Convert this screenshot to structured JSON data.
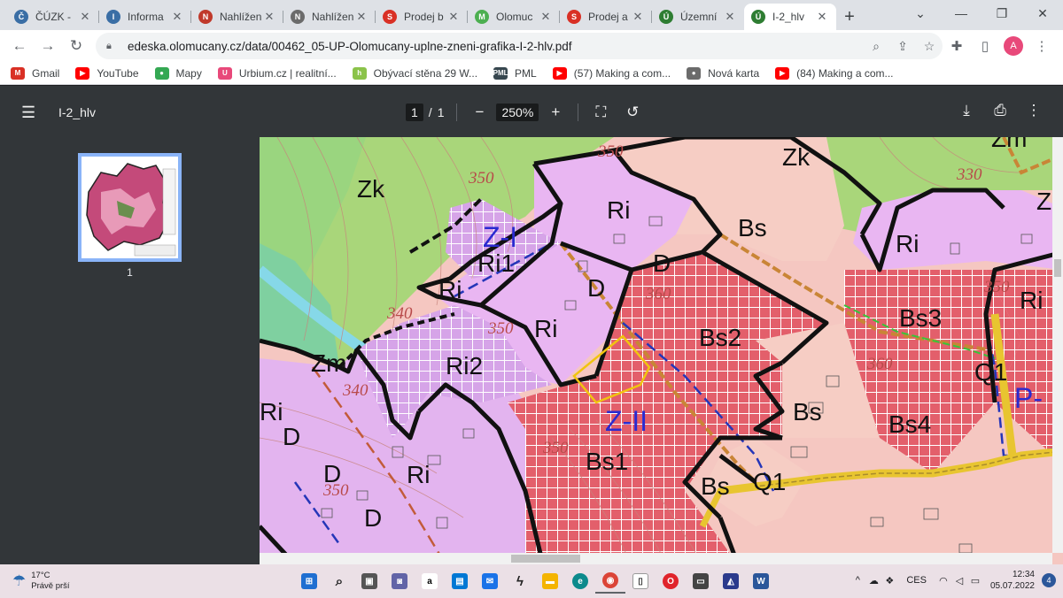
{
  "browser": {
    "tabs": [
      {
        "title": "ČÚZK -",
        "color": "#3a6ea5",
        "glyph": "Č"
      },
      {
        "title": "Informa",
        "color": "#3a6ea5",
        "glyph": "I"
      },
      {
        "title": "Nahlížen",
        "color": "#c0392b",
        "glyph": "N"
      },
      {
        "title": "Nahlížen",
        "color": "#6b6b6b",
        "glyph": "N"
      },
      {
        "title": "Prodej b",
        "color": "#d93025",
        "glyph": "S"
      },
      {
        "title": "Olomuc",
        "color": "#4caf50",
        "glyph": "M"
      },
      {
        "title": "Prodej a",
        "color": "#d93025",
        "glyph": "S"
      },
      {
        "title": "Územní",
        "color": "#2e7d32",
        "glyph": "Ú"
      },
      {
        "title": "I-2_hlv",
        "color": "#2e7d32",
        "glyph": "Ú",
        "active": true
      }
    ],
    "url": "edeska.olomucany.cz/data/00462_05-UP-Olomucany-uplne-zneni-grafika-I-2-hlv.pdf",
    "avatar_letter": "A",
    "bookmarks": [
      {
        "label": "Gmail",
        "color": "#d93025",
        "glyph": "M"
      },
      {
        "label": "YouTube",
        "color": "#ff0000",
        "glyph": "▶"
      },
      {
        "label": "Mapy",
        "color": "#34a853",
        "glyph": "●"
      },
      {
        "label": "Urbium.cz | realitní...",
        "color": "#e8497a",
        "glyph": "U"
      },
      {
        "label": "Obývací stěna 29 W...",
        "color": "#8bc34a",
        "glyph": "h"
      },
      {
        "label": "PML",
        "color": "#37474f",
        "glyph": "PML"
      },
      {
        "label": "(57) Making a com...",
        "color": "#ff0000",
        "glyph": "▶"
      },
      {
        "label": "Nová karta",
        "color": "#6b6b6b",
        "glyph": "●"
      },
      {
        "label": "(84) Making a com...",
        "color": "#ff0000",
        "glyph": "▶"
      }
    ]
  },
  "pdf": {
    "title": "I-2_hlv",
    "page_current": "1",
    "page_separator": "/",
    "page_total": "1",
    "zoom": "250%",
    "thumbnail_label": "1"
  },
  "map": {
    "zone_labels": [
      "Zk",
      "Zk",
      "Zm",
      "Z",
      "Ri",
      "Ri1",
      "Ri",
      "D",
      "D",
      "Ri",
      "Ri",
      "Ri2",
      "Ri",
      "D",
      "D",
      "Ri",
      "D",
      "Bs",
      "Bs2",
      "Bs3",
      "Bs",
      "Bs4",
      "Bs1",
      "Bs",
      "Q1",
      "Q1",
      "Zm",
      "Ri"
    ],
    "plan_labels": [
      "Z-I",
      "Z-II",
      "P-"
    ],
    "contour_labels": [
      "350",
      "350",
      "330",
      "340",
      "350",
      "360",
      "350",
      "360",
      "340",
      "350",
      "350"
    ]
  },
  "taskbar": {
    "temperature": "17°C",
    "weather_text": "Právě prší",
    "language": "CES",
    "time": "12:34",
    "date": "05.07.2022",
    "notifications": "4"
  }
}
